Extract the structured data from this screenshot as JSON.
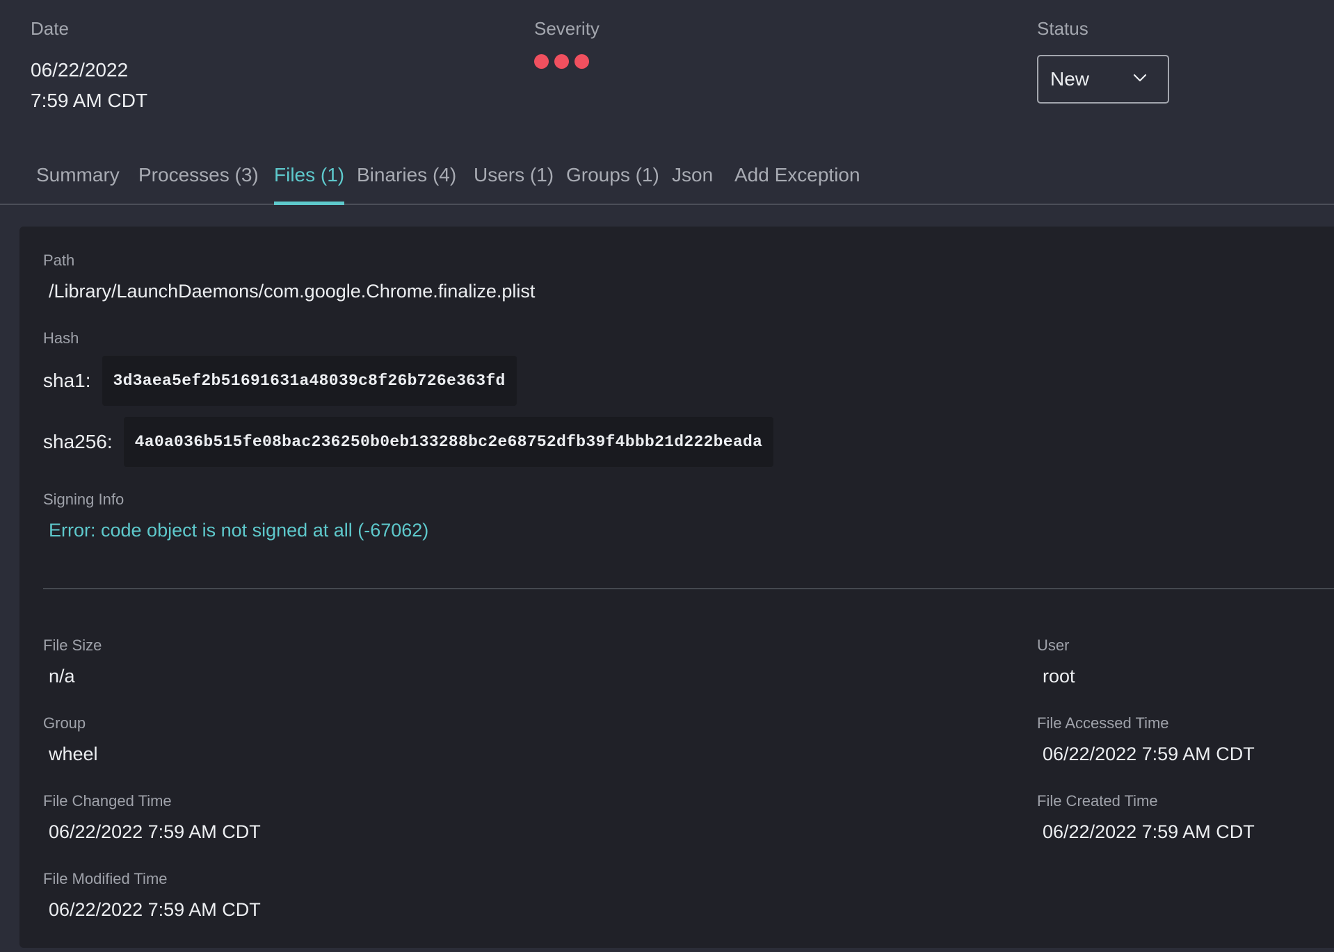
{
  "header": {
    "date_label": "Date",
    "date_value": "06/22/2022",
    "time_value": "7:59 AM CDT",
    "severity_label": "Severity",
    "severity_level": 3,
    "severity_color": "#f0505f",
    "status_label": "Status",
    "status_value": "New",
    "status_icon": "chevron-down-icon"
  },
  "tabs": [
    {
      "label": "Summary"
    },
    {
      "label": "Processes (3)"
    },
    {
      "label": "Files (1)",
      "active": true
    },
    {
      "label": "Binaries (4)"
    },
    {
      "label": "Users (1)"
    },
    {
      "label": "Groups (1)"
    },
    {
      "label": "Json"
    },
    {
      "label": "Add Exception"
    }
  ],
  "accent_color": "#5ec9cc",
  "file": {
    "path_label": "Path",
    "path_value": "/Library/LaunchDaemons/com.google.Chrome.finalize.plist",
    "hash_label": "Hash",
    "sha1_prefix": "sha1:",
    "sha1_value": "3d3aea5ef2b51691631a48039c8f26b726e363fd",
    "sha256_prefix": "sha256:",
    "sha256_value": "4a0a036b515fe08bac236250b0eb133288bc2e68752dfb39f4bbb21d222beada",
    "signing_label": "Signing Info",
    "signing_value": "Error: code object is not signed at all (-67062)",
    "size_label": "File Size",
    "size_value": "n/a",
    "user_label": "User",
    "user_value": "root",
    "group_label": "Group",
    "group_value": "wheel",
    "accessed_label": "File Accessed Time",
    "accessed_value": "06/22/2022 7:59 AM CDT",
    "changed_label": "File Changed Time",
    "changed_value": "06/22/2022 7:59 AM CDT",
    "created_label": "File Created Time",
    "created_value": "06/22/2022 7:59 AM CDT",
    "modified_label": "File Modified Time",
    "modified_value": "06/22/2022 7:59 AM CDT"
  }
}
